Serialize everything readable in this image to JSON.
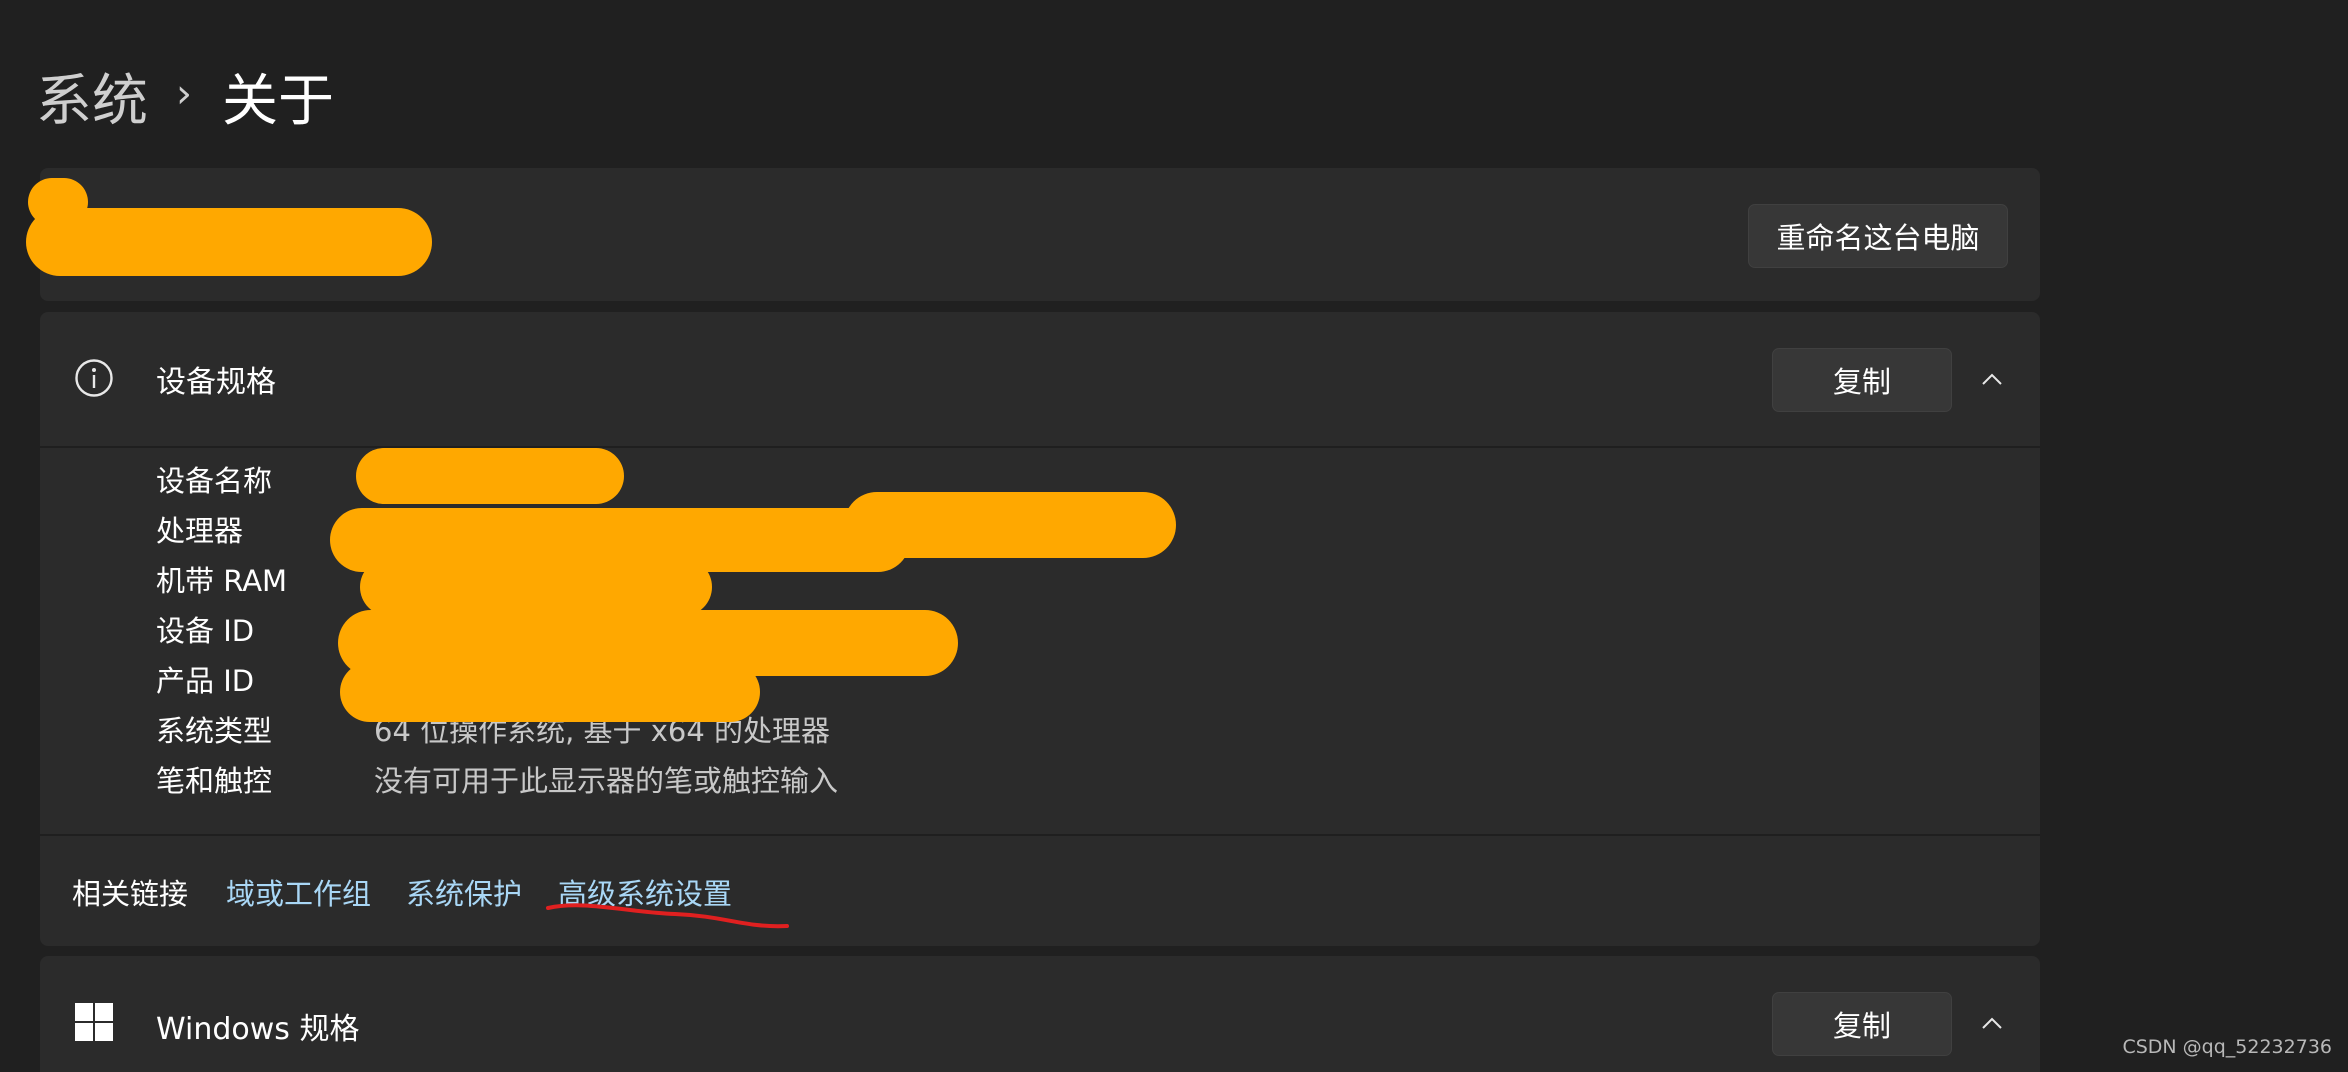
{
  "breadcrumb": {
    "parent": "系统",
    "separator": "›",
    "current": "关于"
  },
  "rename_button": "重命名这台电脑",
  "device_specs": {
    "title": "设备规格",
    "copy_label": "复制",
    "rows": [
      {
        "label": "设备名称",
        "value": ""
      },
      {
        "label": "处理器",
        "value": ""
      },
      {
        "label": "机带 RAM",
        "value": ""
      },
      {
        "label": "设备 ID",
        "value": ""
      },
      {
        "label": "产品 ID",
        "value": ""
      },
      {
        "label": "系统类型",
        "value": "64 位操作系统, 基于 x64 的处理器"
      },
      {
        "label": "笔和触控",
        "value": "没有可用于此显示器的笔或触控输入"
      }
    ]
  },
  "related_links": {
    "title": "相关链接",
    "links": [
      "域或工作组",
      "系统保护",
      "高级系统设置"
    ]
  },
  "windows_specs": {
    "title": "Windows 规格",
    "copy_label": "复制"
  },
  "watermark": "CSDN @qq_52232736",
  "colors": {
    "background": "#202020",
    "card": "#2b2b2b",
    "link": "#a9d7f6",
    "redaction": "#ffa800",
    "annotation": "#e02020"
  }
}
